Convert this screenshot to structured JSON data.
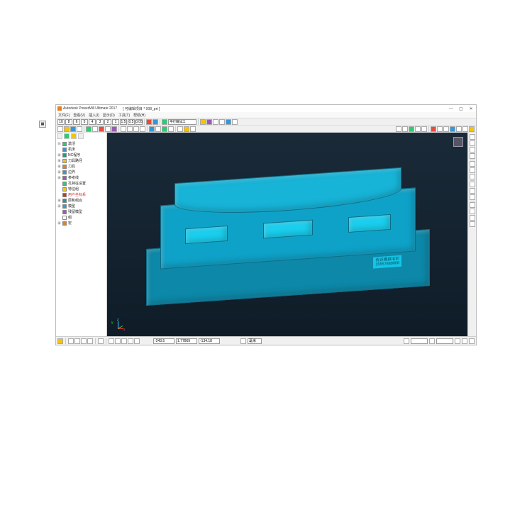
{
  "titlebar": {
    "app": "Autodesk PowerMill Ultimate 2017",
    "project": "[ 可编辑项目 * 008_prt ]"
  },
  "menu": {
    "file": "文件(F)",
    "view": "查看(V)",
    "insert": "插入(I)",
    "display": "显示(D)",
    "tools": "工具(T)",
    "help": "帮助(H)"
  },
  "toolbar": {
    "strategy": "平行精加工",
    "nums": [
      "10",
      "8",
      "6",
      "5",
      "4",
      "3",
      "2",
      "1",
      "1.5",
      "0.5",
      "0.05"
    ]
  },
  "tree": {
    "items": [
      "激活",
      "机床",
      "NC程序",
      "刀具路径",
      "刀具",
      "边界",
      "参考线",
      "孔特征设置",
      "特征组",
      "用户坐标系",
      "层和组合",
      "模型",
      "残留模型",
      "组",
      "宏"
    ]
  },
  "viewport": {
    "watermark_line1": "优识模具培训",
    "watermark_line2": "15557880808",
    "axes": {
      "x": "x",
      "y": "y",
      "z": "z"
    }
  },
  "status": {
    "coord_x": "-243.5",
    "coord_y": "1.77869",
    "coord_z": "-134.18",
    "unit": "毫米"
  }
}
